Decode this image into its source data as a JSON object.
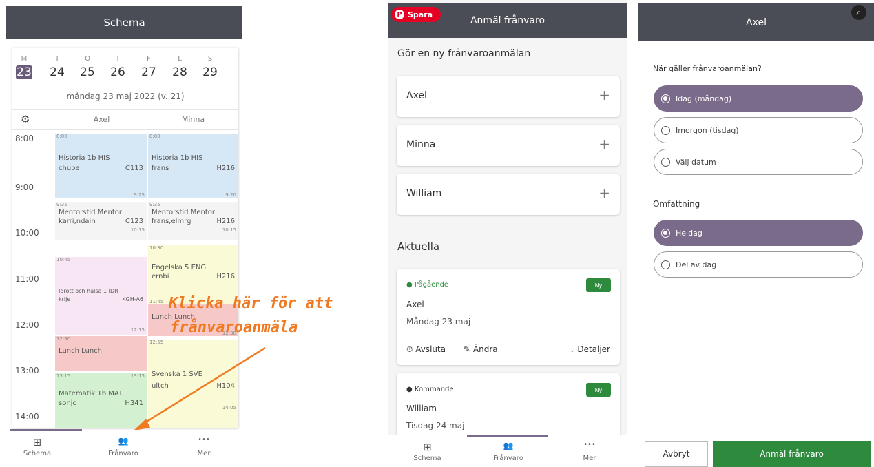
{
  "panel1": {
    "title": "Schema",
    "day_letters": [
      "M",
      "T",
      "O",
      "T",
      "F",
      "L",
      "S"
    ],
    "day_numbers": [
      "23",
      "24",
      "25",
      "26",
      "27",
      "28",
      "29"
    ],
    "date_label": "måndag 23 maj 2022 (v. 21)",
    "students": [
      "Axel",
      "Minna"
    ],
    "times": [
      "8:00",
      "9:00",
      "10:00",
      "11:00",
      "12:00",
      "13:00",
      "14:00"
    ],
    "events": [
      {
        "start": "8:00",
        "end": "9:25",
        "name": "Historia 1b HIS",
        "teacher": "chube",
        "room": "C113",
        "color": "#d6e7f5"
      },
      {
        "start": "9:35",
        "end": "10:15",
        "name": "Mentorstid Mentor",
        "teacher": "karri,ndain",
        "room": "C123",
        "color": "#f4f4f4"
      },
      {
        "start": "10:45",
        "end": "12:15",
        "name": "Idrott och hälsa 1 IDR",
        "teacher": "krije",
        "room": "KGH-A6",
        "color": "#f8e6f5"
      },
      {
        "start": "12:30",
        "end": "",
        "name": "Lunch Lunch",
        "teacher": "",
        "room": "",
        "color": "#f6c8c8"
      },
      {
        "start": "13:15",
        "end": "13:15",
        "name": "Matematik 1b MAT",
        "teacher": "sonjo",
        "room": "H341",
        "color": "#d3f0d0"
      },
      {
        "start": "8:00",
        "end": "9:20",
        "name": "Historia 1b HIS",
        "teacher": "frans",
        "room": "H216",
        "color": "#d6e7f5"
      },
      {
        "start": "9:35",
        "end": "10:15",
        "name": "Mentorstid Mentor",
        "teacher": "frans,elmrg",
        "room": "H216",
        "color": "#f4f4f4"
      },
      {
        "start": "10:30",
        "end": "11:45",
        "name": "Engelska 5 ENG",
        "teacher": "ernbi",
        "room": "H216",
        "color": "#fafad6"
      },
      {
        "start": "",
        "end": "12:30",
        "name": "Lunch Lunch",
        "teacher": "",
        "room": "",
        "color": "#f6c8c8"
      },
      {
        "start": "12:55",
        "end": "14:05",
        "name": "Svenska 1 SVE",
        "teacher": "ultch",
        "room": "H104",
        "color": "#fafad6"
      }
    ],
    "annotation_line1": "Klicka här för att",
    "annotation_line2": "frånvaroanmäla",
    "nav": [
      {
        "icon": "calendar-grid-icon",
        "glyph": "⊞",
        "label": "Schema"
      },
      {
        "icon": "people-icon",
        "glyph": "👥",
        "label": "Frånvaro"
      },
      {
        "icon": "more-icon",
        "glyph": "•••",
        "label": "Mer"
      }
    ]
  },
  "panel2": {
    "save_label": "Spara",
    "title": "Anmäl frånvaro",
    "heading": "Gör en ny frånvaroanmälan",
    "students": [
      "Axel",
      "Minna",
      "William"
    ],
    "plus_glyph": "+",
    "current_heading": "Aktuella",
    "absences": [
      {
        "status": "Pågående",
        "status_color": "#2e8b3e",
        "badge": "Ny",
        "name": "Axel",
        "date": "Måndag 23 maj",
        "end_label": "Avsluta",
        "edit_label": "Ändra",
        "details_label": "Detaljer"
      },
      {
        "status": "Kommande",
        "status_color": "#333333",
        "badge": "Ny",
        "name": "William",
        "date": "Tisdag 24 maj"
      }
    ],
    "nav": [
      {
        "icon": "calendar-grid-icon",
        "glyph": "⊞",
        "label": "Schema"
      },
      {
        "icon": "people-icon",
        "glyph": "👥",
        "label": "Frånvaro"
      },
      {
        "icon": "more-icon",
        "glyph": "•••",
        "label": "Mer"
      }
    ]
  },
  "panel3": {
    "title": "Axel",
    "when_question": "När gäller frånvaroanmälan?",
    "when_options": [
      "Idag (måndag)",
      "Imorgon (tisdag)",
      "Välj datum"
    ],
    "scope_heading": "Omfattning",
    "scope_options": [
      "Heldag",
      "Del av dag"
    ],
    "cancel_label": "Avbryt",
    "submit_label": "Anmäl frånvaro"
  },
  "colors": {
    "header": "#4a4d55",
    "accent_purple": "#7b6b8b",
    "green": "#2e8b3e",
    "annotation": "#f07a22",
    "pin_red": "#e60023"
  }
}
